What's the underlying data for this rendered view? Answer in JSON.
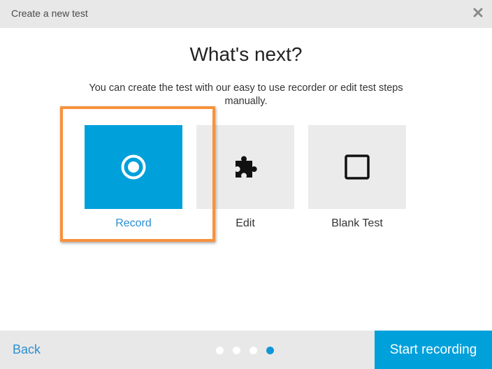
{
  "dialog": {
    "title": "Create a new test",
    "close_icon": "close-icon"
  },
  "heading": "What's next?",
  "subtitle": "You can create the test with our easy to use recorder or edit test steps manually.",
  "options": [
    {
      "label": "Record",
      "icon": "record-icon",
      "selected": true
    },
    {
      "label": "Edit",
      "icon": "puzzle-icon",
      "selected": false
    },
    {
      "label": "Blank Test",
      "icon": "square-icon",
      "selected": false
    }
  ],
  "footer": {
    "back_label": "Back",
    "primary_label": "Start recording",
    "step_total": 4,
    "step_current": 4
  },
  "colors": {
    "accent": "#00a0db",
    "highlight": "#f7923c",
    "link": "#2b8fd0"
  }
}
